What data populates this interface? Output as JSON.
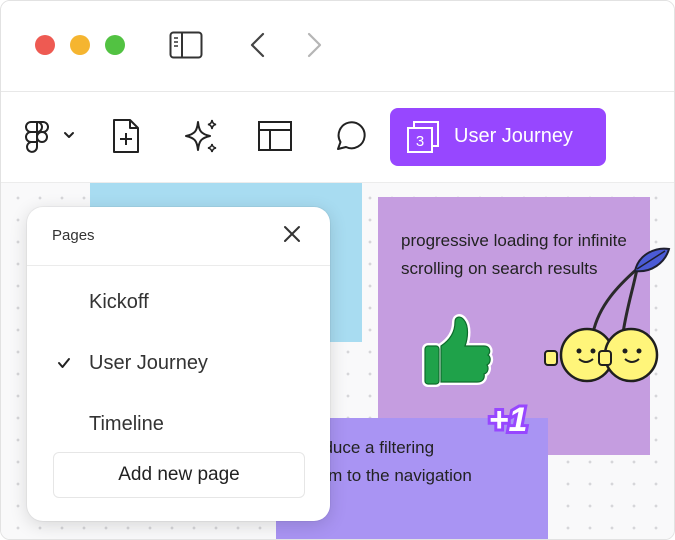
{
  "toolbar": {
    "current_page_number": "3",
    "current_page_label": "User Journey",
    "accent_color": "#9747ff"
  },
  "icons": {
    "app_menu": "figma-logo-icon",
    "new_file": "add-file-icon",
    "ai": "sparkle-icon",
    "layout": "layout-icon",
    "comment": "comment-icon"
  },
  "pages_panel": {
    "title": "Pages",
    "items": [
      {
        "label": "Kickoff",
        "selected": false
      },
      {
        "label": "User Journey",
        "selected": true
      },
      {
        "label": "Timeline",
        "selected": false
      }
    ],
    "add_label": "Add new page"
  },
  "canvas": {
    "sticky_purple_text": "progressive loading for infinite scrolling on search results",
    "sticky_lavender_text": "oduce a filtering\ntem to the navigation",
    "sticker_plus": "+1",
    "colors": {
      "sticky_blue": "#a8dcf1",
      "sticky_purple": "#c59de0",
      "sticky_lavender": "#a994f3"
    }
  }
}
